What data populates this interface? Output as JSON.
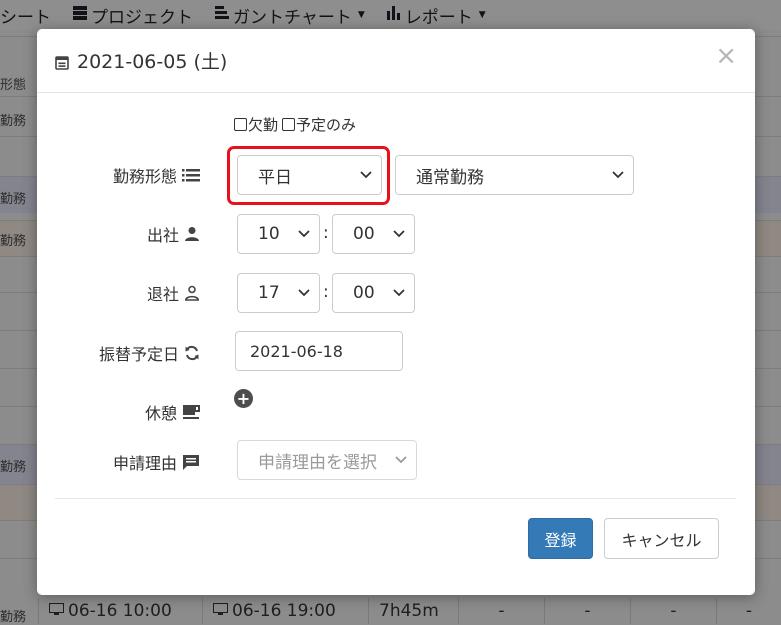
{
  "nav": {
    "items": [
      {
        "label": "シート",
        "icon": "",
        "caret": false
      },
      {
        "label": "プロジェクト",
        "icon": "server-icon",
        "caret": false
      },
      {
        "label": "ガントチャート",
        "icon": "gantt-icon",
        "caret": true
      },
      {
        "label": "レポート",
        "icon": "bar-chart-icon",
        "caret": true
      }
    ]
  },
  "background": {
    "column_header": "形態",
    "row_labels": [
      "勤務",
      "勤務",
      "勤務",
      "勤務",
      "勤務"
    ],
    "bottom_row": {
      "start": "06-16 10:00",
      "end": "06-16 19:00",
      "duration": "7h45m",
      "dashes": [
        "-",
        "-",
        "-",
        "-"
      ]
    }
  },
  "modal": {
    "title": "2021-06-05 (土)",
    "close_label": "×",
    "absence_label": "欠勤",
    "scheduled_only_label": "予定のみ",
    "work_type": {
      "label": "勤務形態",
      "day_type_value": "平日",
      "shift_value": "通常勤務"
    },
    "clock_in": {
      "label": "出社",
      "hour": "10",
      "minute": "00"
    },
    "clock_out": {
      "label": "退社",
      "hour": "17",
      "minute": "00"
    },
    "substitute": {
      "label": "振替予定日",
      "value": "2021-06-18"
    },
    "break": {
      "label": "休憩",
      "add_label": "+"
    },
    "reason": {
      "label": "申請理由",
      "placeholder": "申請理由を選択"
    },
    "time_separator": ":",
    "register_label": "登録",
    "cancel_label": "キャンセル"
  },
  "colors": {
    "primary": "#337ab7",
    "highlight": "#e8101a",
    "overlay": "#8c8c8c"
  }
}
